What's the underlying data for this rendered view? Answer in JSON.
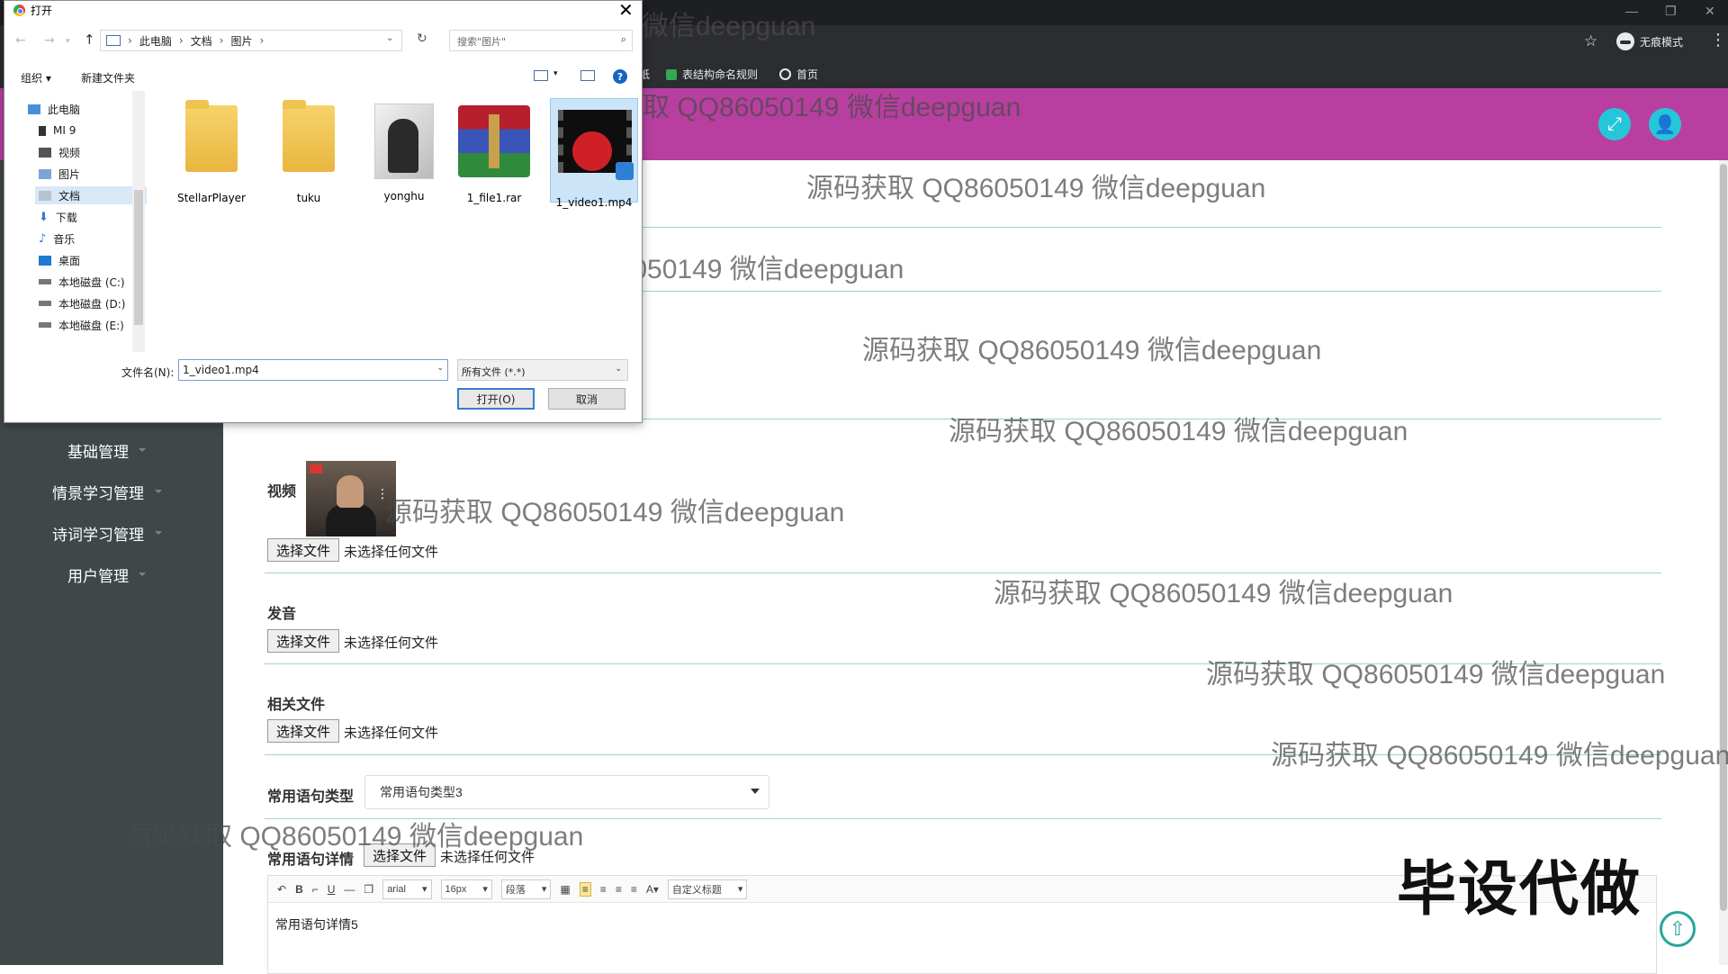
{
  "browser": {
    "bookmarks": [
      {
        "label": "纸"
      },
      {
        "label": "表结构命名规则"
      },
      {
        "label": "首页"
      }
    ],
    "incognito_label": "无痕模式",
    "colors": {
      "chrome_bg": "#2b2d31"
    }
  },
  "header": {
    "color": "#b83fa0",
    "fullscreen_icon": "expand-icon",
    "user_icon": "user-icon"
  },
  "sidebar": {
    "items": [
      {
        "label": "基础管理"
      },
      {
        "label": "情景学习管理"
      },
      {
        "label": "诗词学习管理"
      },
      {
        "label": "用户管理"
      }
    ]
  },
  "form": {
    "video": {
      "label": "视频",
      "button": "选择文件",
      "hint": "未选择任何文件"
    },
    "audio": {
      "label": "发音",
      "button": "选择文件",
      "hint": "未选择任何文件"
    },
    "files": {
      "label": "相关文件",
      "button": "选择文件",
      "hint": "未选择任何文件"
    },
    "phrase_type": {
      "label": "常用语句类型",
      "value": "常用语句类型3"
    },
    "phrase_detail": {
      "label": "常用语句详情",
      "button": "选择文件",
      "hint": "未选择任何文件"
    },
    "editor": {
      "font_family": "arial",
      "font_size": "16px",
      "paragraph": "段落",
      "custom_title": "自定义标题",
      "content": "常用语句详情5"
    }
  },
  "promo_text": "毕设代做",
  "watermark": "源码获取 QQ86050149 微信deepguan",
  "dialog": {
    "title": "打开",
    "breadcrumbs": [
      "此电脑",
      "文档",
      "图片"
    ],
    "search_placeholder": "搜索\"图片\"",
    "organize": "组织 ▾",
    "new_folder": "新建文件夹",
    "nav_items": [
      {
        "label": "此电脑",
        "icon": "computer-icon"
      },
      {
        "label": "MI 9",
        "icon": "phone-icon"
      },
      {
        "label": "视频",
        "icon": "video-folder-icon"
      },
      {
        "label": "图片",
        "icon": "pictures-folder-icon"
      },
      {
        "label": "文档",
        "icon": "documents-folder-icon"
      },
      {
        "label": "下载",
        "icon": "download-icon"
      },
      {
        "label": "音乐",
        "icon": "music-icon"
      },
      {
        "label": "桌面",
        "icon": "desktop-icon"
      },
      {
        "label": "本地磁盘 (C:)",
        "icon": "drive-icon"
      },
      {
        "label": "本地磁盘 (D:)",
        "icon": "drive-icon"
      },
      {
        "label": "本地磁盘 (E:)",
        "icon": "drive-icon"
      }
    ],
    "files": [
      {
        "name": "StellarPlayer",
        "kind": "folder"
      },
      {
        "name": "tuku",
        "kind": "folder"
      },
      {
        "name": "yonghu",
        "kind": "image-folder"
      },
      {
        "name": "1_file1.rar",
        "kind": "archive"
      },
      {
        "name": "1_video1.mp4",
        "kind": "video"
      }
    ],
    "filename_label": "文件名(N):",
    "filename_value": "1_video1.mp4",
    "filetype": "所有文件 (*.*)",
    "open_label": "打开(O)",
    "cancel_label": "取消"
  }
}
